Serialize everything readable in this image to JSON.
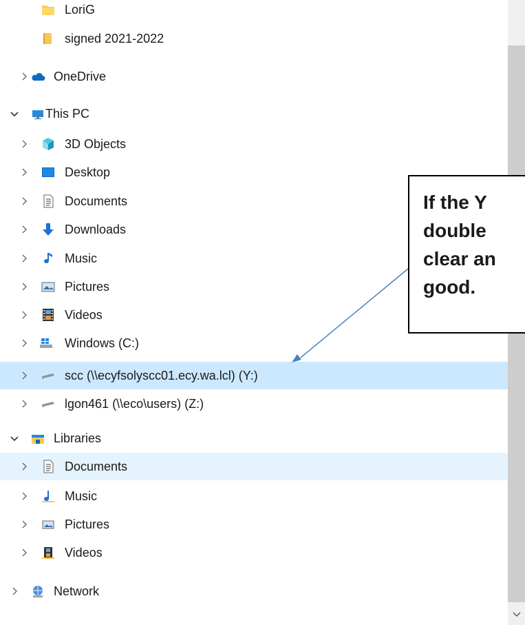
{
  "tree": {
    "items": [
      {
        "label": "LoriG",
        "icon": "folder-icon"
      },
      {
        "label": "signed 2021-2022",
        "icon": "folder-icon"
      },
      {
        "label": "OneDrive",
        "icon": "onedrive-cloud-icon"
      },
      {
        "label": "This PC",
        "icon": "computer-icon"
      },
      {
        "label": "3D Objects",
        "icon": "3d-objects-icon"
      },
      {
        "label": "Desktop",
        "icon": "desktop-icon"
      },
      {
        "label": "Documents",
        "icon": "documents-icon"
      },
      {
        "label": "Downloads",
        "icon": "download-arrow-icon"
      },
      {
        "label": "Music",
        "icon": "music-note-icon"
      },
      {
        "label": "Pictures",
        "icon": "pictures-icon"
      },
      {
        "label": "Videos",
        "icon": "film-strip-icon"
      },
      {
        "label": "Windows (C:)",
        "icon": "windows-drive-icon"
      },
      {
        "label": "scc (\\\\ecyfsolyscc01.ecy.wa.lcl) (Y:)",
        "icon": "network-drive-icon"
      },
      {
        "label": "lgon461 (\\\\eco\\users) (Z:)",
        "icon": "network-drive-icon"
      },
      {
        "label": "Libraries",
        "icon": "libraries-icon"
      },
      {
        "label": "Documents",
        "icon": "library-documents-icon"
      },
      {
        "label": "Music",
        "icon": "library-music-icon"
      },
      {
        "label": "Pictures",
        "icon": "library-pictures-icon"
      },
      {
        "label": "Videos",
        "icon": "library-videos-icon"
      },
      {
        "label": "Network",
        "icon": "network-icon"
      }
    ]
  },
  "callout": {
    "lines": [
      "If the Y",
      "double",
      "clear an",
      "good."
    ]
  },
  "colors": {
    "selected_row": "#cce8ff",
    "hover_row": "#e5f3ff",
    "arrow": "#4a7fc0"
  }
}
